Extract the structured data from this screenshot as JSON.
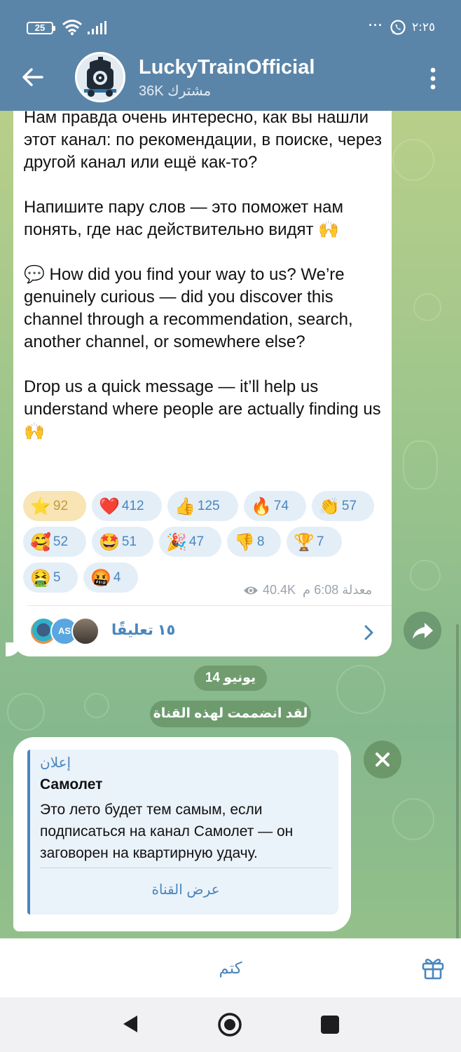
{
  "status_bar": {
    "battery": "25",
    "more": "···",
    "time": "٢:٢٥"
  },
  "header": {
    "channel_name": "LuckyTrainOfficial",
    "subscribers": "36K مشترك"
  },
  "message": {
    "text": "Нам правда очень интересно, как вы нашли этот канал: по рекомендации, в поиске, через другой канал или ещё как-то?\n\nНапишите пару слов — это поможет нам понять, где нас действительно видят 🙌\n\n💬 How did you find your way to us? We’re genuinely curious — did you discover this channel through a recommendation, search, another channel, or somewhere else?\n\nDrop us a quick message — it’ll help us understand where people are actually finding us 🙌",
    "reactions": [
      {
        "emoji": "⭐",
        "count": "92",
        "active": true
      },
      {
        "emoji": "❤️",
        "count": "412",
        "active": false
      },
      {
        "emoji": "👍",
        "count": "125",
        "active": false
      },
      {
        "emoji": "🔥",
        "count": "74",
        "active": false
      },
      {
        "emoji": "👏",
        "count": "57",
        "active": false
      },
      {
        "emoji": "🥰",
        "count": "52",
        "active": false
      },
      {
        "emoji": "🤩",
        "count": "51",
        "active": false
      },
      {
        "emoji": "🎉",
        "count": "47",
        "active": false
      },
      {
        "emoji": "👎",
        "count": "8",
        "active": false
      },
      {
        "emoji": "🏆",
        "count": "7",
        "active": false
      },
      {
        "emoji": "🤮",
        "count": "5",
        "active": false
      },
      {
        "emoji": "🤬",
        "count": "4",
        "active": false
      }
    ],
    "views": "40.4K",
    "edited_time": "معدلة 6:08 م",
    "comments_label": "١٥ تعليقًا",
    "comment_avatar_initials": "AS"
  },
  "service": {
    "date": "14 يونيو",
    "joined": "لقد انضممت لهذه القناة"
  },
  "ad": {
    "label": "إعلان",
    "title": "Самолет",
    "text": "Это лето будет тем самым, если подписаться на канал Самолет — он заговорен на квартирную удачу.",
    "button": "عرض القناة"
  },
  "bottom": {
    "mute_label": "كتم"
  },
  "icons": {
    "back": "arrow-left-icon",
    "menu": "more-vertical-icon",
    "share": "share-icon",
    "close": "close-icon",
    "gift": "gift-icon",
    "views": "eye-icon"
  },
  "colors": {
    "header": "#5b85a8",
    "accent": "#4a86bd",
    "active_reaction": "#f8e4b4",
    "reaction": "#e4eef7"
  }
}
